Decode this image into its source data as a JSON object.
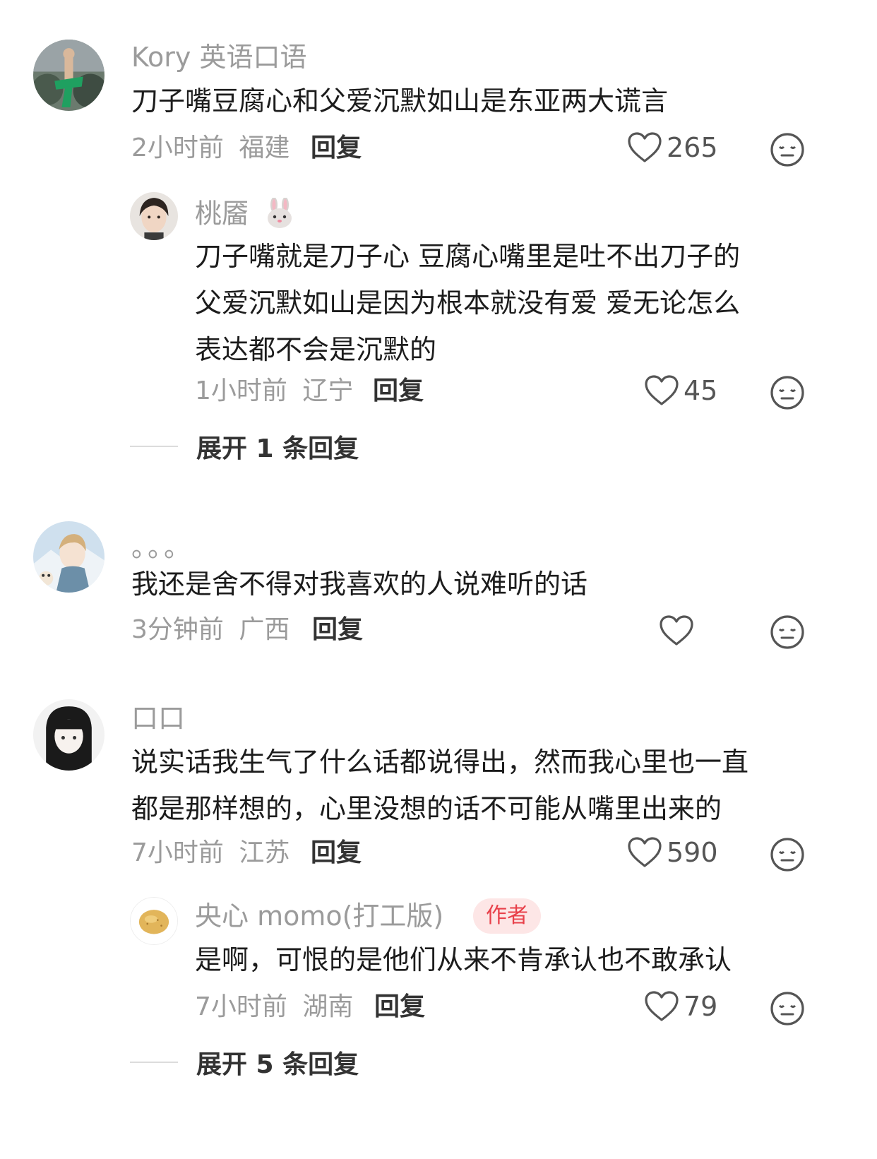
{
  "comments": [
    {
      "name": "Kory 英语口语",
      "lines": [
        "刀子嘴豆腐心和父爱沉默如山是东亚两大谎言"
      ],
      "time": "2小时前",
      "region": "福建",
      "reply": "回复",
      "likes": "265",
      "replies": [
        {
          "name": "桃靥",
          "name_emoji": "rabbit-emoji",
          "lines": [
            "刀子嘴就是刀子心 豆腐心嘴里是吐不出刀子的",
            "父爱沉默如山是因为根本就没有爱 爱无论怎么",
            "表达都不会是沉默的"
          ],
          "time": "1小时前",
          "region": "辽宁",
          "reply": "回复",
          "likes": "45"
        }
      ],
      "expand": "展开 1 条回复"
    },
    {
      "name": "。。。",
      "lines": [
        "我还是舍不得对我喜欢的人说难听的话"
      ],
      "time": "3分钟前",
      "region": "广西",
      "reply": "回复",
      "likes": ""
    },
    {
      "name": "口口",
      "lines": [
        "说实话我生气了什么话都说得出，然而我心里也一直",
        "都是那样想的，心里没想的话不可能从嘴里出来的"
      ],
      "time": "7小时前",
      "region": "江苏",
      "reply": "回复",
      "likes": "590",
      "replies": [
        {
          "name": "央心 momo(打工版)",
          "badge": "作者",
          "lines": [
            "是啊，可恨的是他们从来不肯承认也不敢承认"
          ],
          "time": "7小时前",
          "region": "湖南",
          "reply": "回复",
          "likes": "79"
        }
      ],
      "expand": "展开 5 条回复"
    }
  ],
  "icons": {
    "like": "heart-outline-icon",
    "dislike": "meh-face-icon"
  },
  "colors": {
    "name": "#9b9b9b",
    "content": "#1c1c1c",
    "badge_bg": "#fde6e6",
    "badge_text": "#e8404a"
  }
}
